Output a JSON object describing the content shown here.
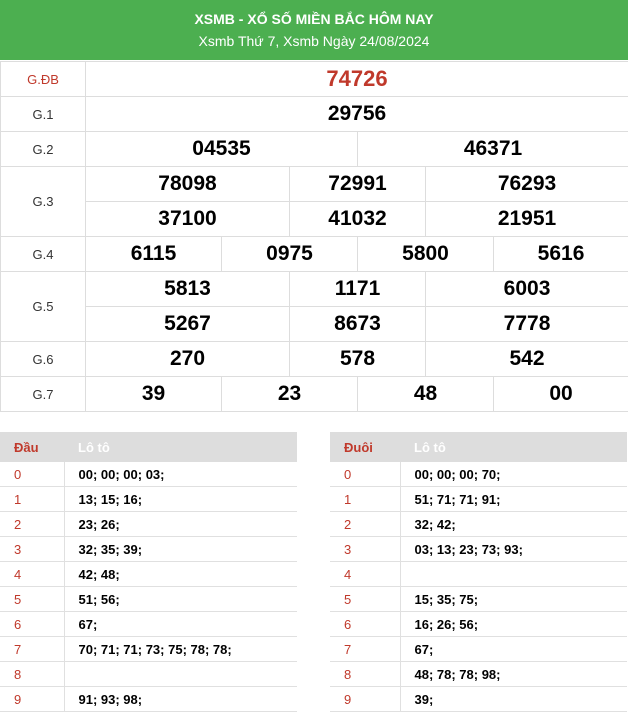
{
  "header": {
    "title": "XSMB - XỔ SỐ MIỀN BẮC HÔM NAY",
    "subtitle": "Xsmb Thứ 7, Xsmb Ngày 24/08/2024"
  },
  "results": {
    "g_db": {
      "label": "G.ĐB",
      "numbers": [
        "74726"
      ]
    },
    "g1": {
      "label": "G.1",
      "numbers": [
        "29756"
      ]
    },
    "g2": {
      "label": "G.2",
      "numbers": [
        "04535",
        "46371"
      ]
    },
    "g3": {
      "label": "G.3",
      "numbers": [
        "78098",
        "72991",
        "76293",
        "37100",
        "41032",
        "21951"
      ]
    },
    "g4": {
      "label": "G.4",
      "numbers": [
        "6115",
        "0975",
        "5800",
        "5616"
      ]
    },
    "g5": {
      "label": "G.5",
      "numbers": [
        "5813",
        "1171",
        "6003",
        "5267",
        "8673",
        "7778"
      ]
    },
    "g6": {
      "label": "G.6",
      "numbers": [
        "270",
        "578",
        "542"
      ]
    },
    "g7": {
      "label": "G.7",
      "numbers": [
        "39",
        "23",
        "48",
        "00"
      ]
    }
  },
  "loto_dau": {
    "col1": "Đầu",
    "col2": "Lô tô",
    "rows": [
      {
        "k": "0",
        "v": "00; 00; 00; 03;"
      },
      {
        "k": "1",
        "v": "13; 15; 16;"
      },
      {
        "k": "2",
        "v": "23; 26;"
      },
      {
        "k": "3",
        "v": "32; 35; 39;"
      },
      {
        "k": "4",
        "v": "42; 48;"
      },
      {
        "k": "5",
        "v": "51; 56;"
      },
      {
        "k": "6",
        "v": "67;"
      },
      {
        "k": "7",
        "v": "70; 71; 71; 73; 75; 78; 78;"
      },
      {
        "k": "8",
        "v": ""
      },
      {
        "k": "9",
        "v": "91; 93; 98;"
      }
    ]
  },
  "loto_duoi": {
    "col1": "Đuôi",
    "col2": "Lô tô",
    "rows": [
      {
        "k": "0",
        "v": "00; 00; 00; 70;"
      },
      {
        "k": "1",
        "v": "51; 71; 71; 91;"
      },
      {
        "k": "2",
        "v": "32; 42;"
      },
      {
        "k": "3",
        "v": "03; 13; 23; 73; 93;"
      },
      {
        "k": "4",
        "v": ""
      },
      {
        "k": "5",
        "v": "15; 35; 75;"
      },
      {
        "k": "6",
        "v": "16; 26; 56;"
      },
      {
        "k": "7",
        "v": "67;"
      },
      {
        "k": "8",
        "v": "48; 78; 78; 98;"
      },
      {
        "k": "9",
        "v": "39;"
      }
    ]
  },
  "colors": {
    "header_bg": "#4caf50",
    "accent_red": "#c0392b",
    "table_header_bg": "#dddddd"
  }
}
